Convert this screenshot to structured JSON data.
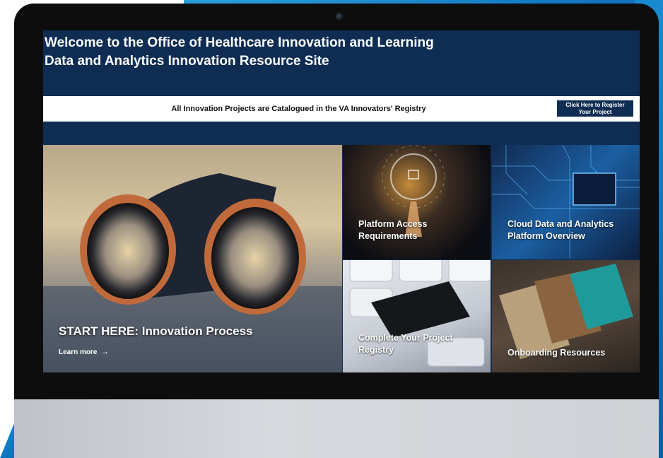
{
  "header": {
    "title_line1": "Welcome to the Office of Healthcare Innovation and Learning",
    "title_line2": "Data and Analytics Innovation Resource Site"
  },
  "registry_banner": {
    "text": "All Innovation Projects are Catalogued in the VA Innovators' Registry",
    "button_line1": "Click Here to Register",
    "button_line2": "Your Project"
  },
  "tiles": {
    "start": {
      "title": "START HERE: Innovation Process",
      "link": "Learn more"
    },
    "platform": {
      "line1": "Platform Access",
      "line2": "Requirements"
    },
    "cloud": {
      "line1": "Cloud Data and Analytics",
      "line2": "Platform Overview"
    },
    "complete": {
      "line1": "Complete Your Project",
      "line2": "Registry"
    },
    "onboarding": {
      "line1": "Onboarding Resources"
    }
  },
  "colors": {
    "header_bg": "#0f2d52",
    "banner_bg": "#ffffff",
    "accent_blue": "#1e90d6"
  },
  "icons": {
    "learn_more": "arrow-right-icon"
  }
}
